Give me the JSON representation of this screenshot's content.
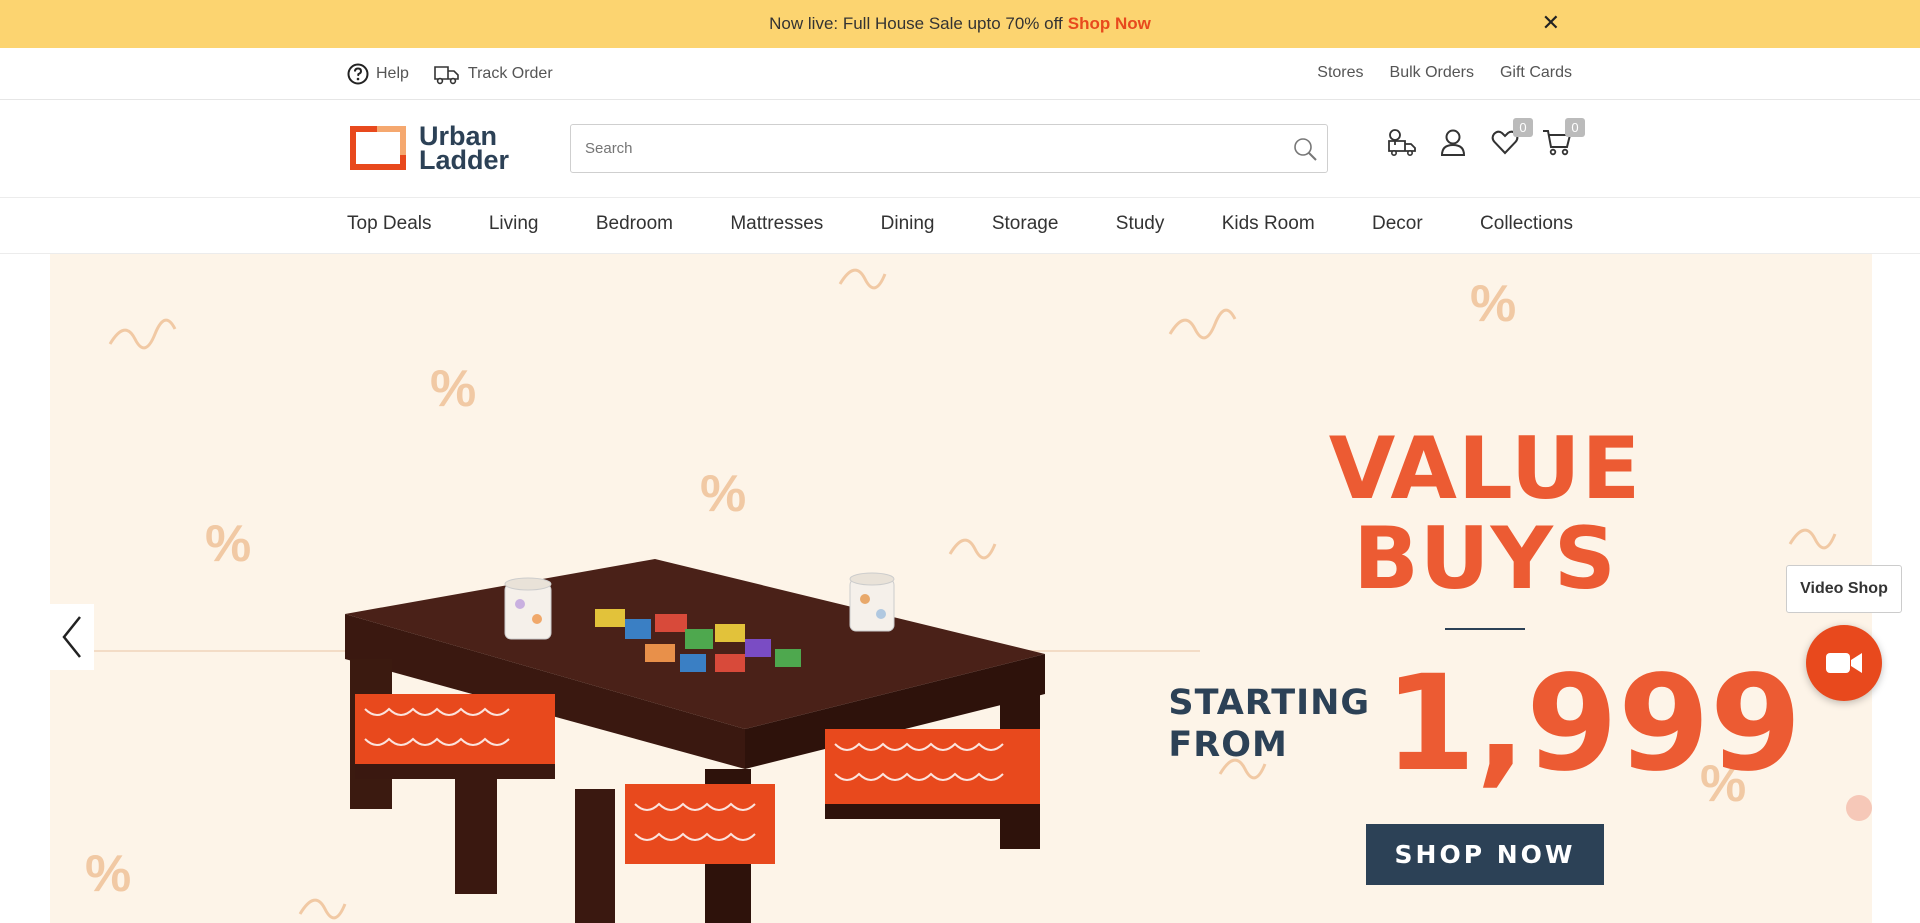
{
  "announcement": {
    "text": "Now live: Full House Sale upto 70% off",
    "cta": "Shop Now",
    "close_glyph": "✕"
  },
  "utility": {
    "help": "Help",
    "track_order": "Track Order",
    "stores": "Stores",
    "bulk_orders": "Bulk Orders",
    "gift_cards": "Gift Cards"
  },
  "logo": {
    "line1": "Urban",
    "line2": "Ladder",
    "brand_color": "#e8491d"
  },
  "search": {
    "placeholder": "Search",
    "value": ""
  },
  "header": {
    "wishlist_count": "0",
    "cart_count": "0"
  },
  "nav": {
    "items": [
      "Top Deals",
      "Living",
      "Bedroom",
      "Mattresses",
      "Dining",
      "Storage",
      "Study",
      "Kids Room",
      "Decor",
      "Collections"
    ]
  },
  "banner": {
    "title": "VALUE BUYS",
    "starting_line1": "STARTING",
    "starting_line2": "FROM",
    "price": "1,999",
    "button": "SHOP NOW",
    "accent": "#ec5b33",
    "navy": "#2c4156",
    "background": "#fdf4e8"
  },
  "video_shop": {
    "label": "Video Shop"
  }
}
